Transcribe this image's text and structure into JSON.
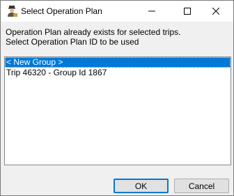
{
  "window": {
    "title": "Select Operation Plan",
    "app_icon": "user-icon"
  },
  "titlebar_buttons": {
    "minimize": "minimize-icon",
    "maximize": "maximize-icon",
    "close": "close-icon"
  },
  "message": {
    "line1": "Operation Plan already exists for selected trips.",
    "line2": "Select Operation Plan ID to be used"
  },
  "plans": {
    "items": [
      {
        "label": "< New Group >",
        "selected": true
      },
      {
        "label": "Trip 46320 - Group Id 1867",
        "selected": false
      }
    ]
  },
  "buttons": {
    "ok": "OK",
    "cancel": "Cancel"
  },
  "colors": {
    "selection": "#0078d7",
    "dialog_bg": "#f0f0f0"
  }
}
